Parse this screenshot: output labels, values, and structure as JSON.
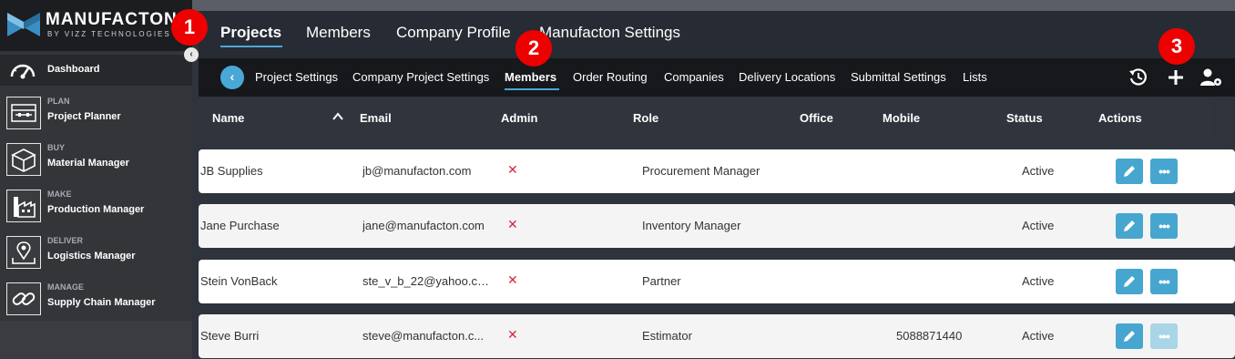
{
  "brand": {
    "name": "MANUFACTON",
    "tagline": "BY VIZZ TECHNOLOGIES"
  },
  "sidebar": {
    "dashboard_label": "Dashboard",
    "items": [
      {
        "section": "PLAN",
        "label": "Project Planner",
        "icon": "planner-icon"
      },
      {
        "section": "BUY",
        "label": "Material Manager",
        "icon": "box-icon"
      },
      {
        "section": "MAKE",
        "label": "Production Manager",
        "icon": "factory-icon"
      },
      {
        "section": "DELIVER",
        "label": "Logistics Manager",
        "icon": "map-pin-icon"
      },
      {
        "section": "MANAGE",
        "label": "Supply Chain Manager",
        "icon": "chain-link-icon"
      }
    ]
  },
  "topnav": {
    "tabs": [
      "Projects",
      "Members",
      "Company Profile",
      "Manufacton Settings"
    ],
    "active": "Projects"
  },
  "subnav": {
    "tabs": [
      "Project Settings",
      "Company Project Settings",
      "Members",
      "Order Routing",
      "Companies",
      "Delivery Locations",
      "Submittal Settings",
      "Lists"
    ],
    "active": "Members"
  },
  "table": {
    "headers": {
      "name": "Name",
      "email": "Email",
      "admin": "Admin",
      "role": "Role",
      "office": "Office",
      "mobile": "Mobile",
      "status": "Status",
      "actions": "Actions"
    },
    "rows": [
      {
        "name": "JB Supplies",
        "email": "jb@manufacton.com",
        "admin": "✕",
        "role": "Procurement Manager",
        "office": "",
        "mobile": "",
        "status": "Active",
        "more_enabled": true
      },
      {
        "name": "Jane Purchase",
        "email": "jane@manufacton.com",
        "admin": "✕",
        "role": "Inventory Manager",
        "office": "",
        "mobile": "",
        "status": "Active",
        "more_enabled": true
      },
      {
        "name": "Stein VonBack",
        "email": "ste_v_b_22@yahoo.co...",
        "admin": "✕",
        "role": "Partner",
        "office": "",
        "mobile": "",
        "status": "Active",
        "more_enabled": true
      },
      {
        "name": "Steve Burri",
        "email": "steve@manufacton.c...",
        "admin": "✕",
        "role": "Estimator",
        "office": "",
        "mobile": "5088871440",
        "status": "Active",
        "more_enabled": false
      }
    ]
  },
  "callouts": [
    "1",
    "2",
    "3"
  ],
  "colors": {
    "accent": "#4aa8d8",
    "callout": "#e00000",
    "admin_no": "#d7263d"
  }
}
